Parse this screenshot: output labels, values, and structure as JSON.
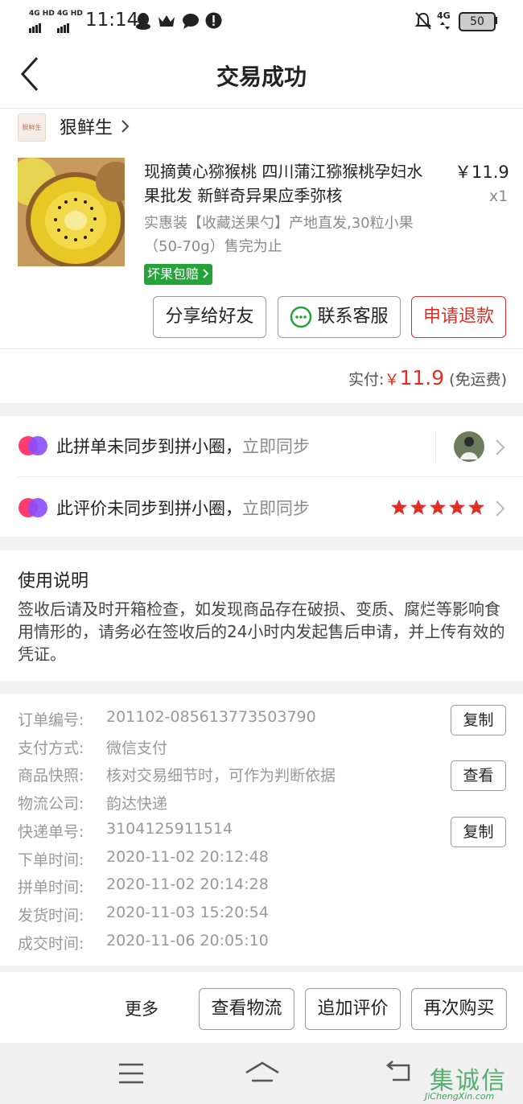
{
  "status_bar": {
    "network1": "4G HD",
    "network2": "4G HD",
    "time": "11:14",
    "network3": "4G",
    "battery": "50"
  },
  "header": {
    "title": "交易成功"
  },
  "shop": {
    "logo_text": "狠鲜生",
    "name": "狠鲜生"
  },
  "product": {
    "title": "现摘黄心猕猴桃 四川蒲江猕猴桃孕妇水果批发 新鲜奇异果应季弥核",
    "spec": "实惠装【收藏送果勺】产地直发,30粒小果（50-70g）售完为止",
    "price": "￥11.9",
    "quantity": "x1",
    "badge": "坏果包赔"
  },
  "actions": {
    "share": "分享给好友",
    "contact": "联系客服",
    "refund": "申请退款"
  },
  "payment": {
    "label": "实付:",
    "currency": "￥",
    "amount": "11.9",
    "note": "(免运费)"
  },
  "sync": {
    "order_text": "此拼单未同步到拼小圈，",
    "order_link": "立即同步",
    "review_text": "此评价未同步到拼小圈，",
    "review_link": "立即同步",
    "stars": 5
  },
  "instructions": {
    "title": "使用说明",
    "body": "签收后请及时开箱检查，如发现商品存在破损、变质、腐烂等影响食用情形的，请务必在签收后的24小时内发起售后申请，并上传有效的凭证。"
  },
  "order_info": {
    "rows": [
      {
        "label": "订单编号:",
        "value": "201102-085613773503790",
        "button": "复制"
      },
      {
        "label": "支付方式:",
        "value": "微信支付"
      },
      {
        "label": "商品快照:",
        "value": "核对交易细节时，可作为判断依据",
        "button": "查看"
      },
      {
        "label": "物流公司:",
        "value": "韵达快递"
      },
      {
        "label": "快递单号:",
        "value": "3104125911514",
        "button": "复制"
      },
      {
        "label": "下单时间:",
        "value": "2020-11-02 20:12:48"
      },
      {
        "label": "拼单时间:",
        "value": "2020-11-02 20:14:28"
      },
      {
        "label": "发货时间:",
        "value": "2020-11-03 15:20:54"
      },
      {
        "label": "成交时间:",
        "value": "2020-11-06 20:05:10"
      }
    ]
  },
  "bottom_bar": {
    "more": "更多",
    "logistics": "查看物流",
    "add_review": "追加评价",
    "buy_again": "再次购买"
  },
  "watermark": {
    "chars": "集诚信",
    "domain": "JiChengXin.com"
  }
}
